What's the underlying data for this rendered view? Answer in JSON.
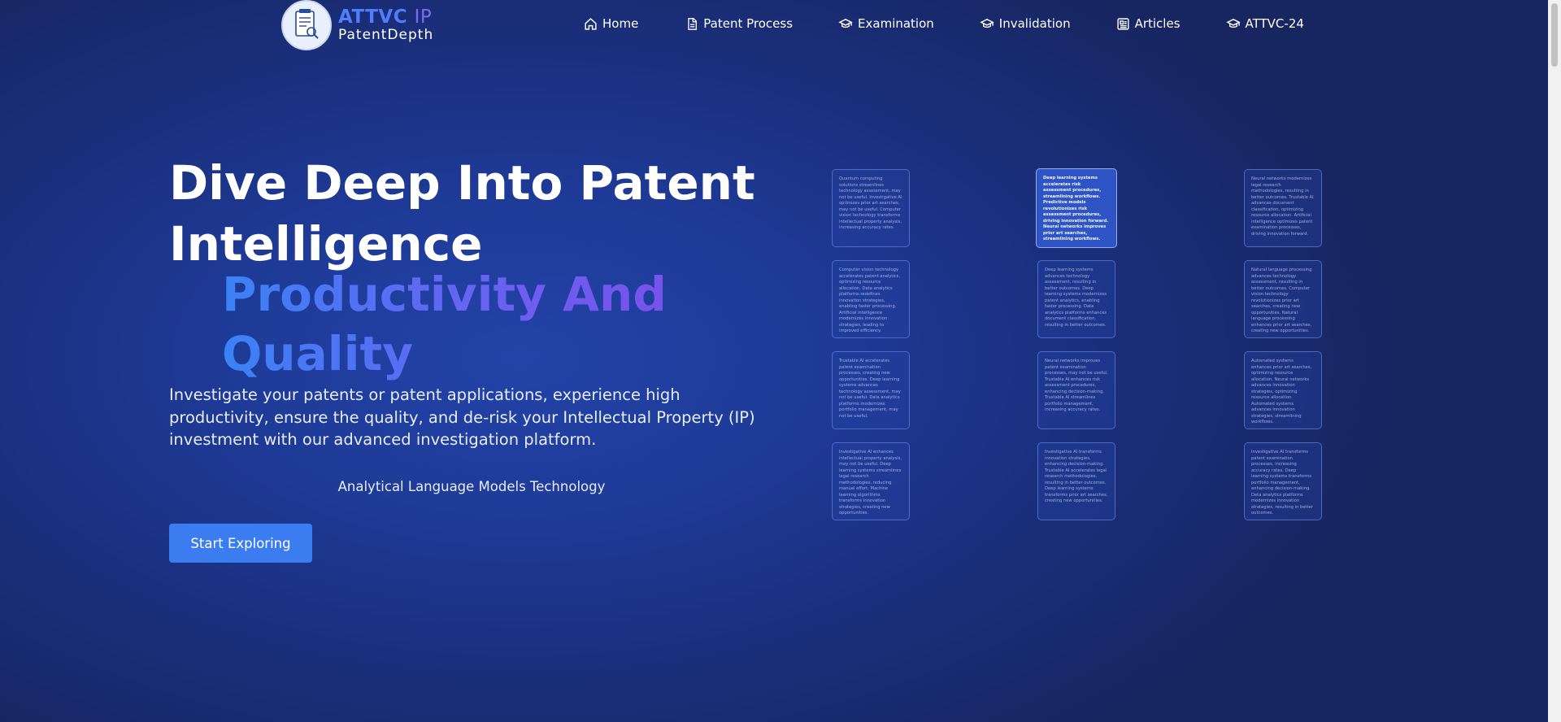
{
  "brand": {
    "name_main": "ATTVC",
    "name_suffix": "IP",
    "tagline": "PatentDepth",
    "colors": {
      "main": "#4f7dfb",
      "suffix": "#7c69f0"
    }
  },
  "nav": {
    "items": [
      {
        "label": "Home",
        "icon": "home-icon"
      },
      {
        "label": "Patent Process",
        "icon": "document-icon"
      },
      {
        "label": "Examination",
        "icon": "graduation-cap-icon"
      },
      {
        "label": "Invalidation",
        "icon": "graduation-cap-icon"
      },
      {
        "label": "Articles",
        "icon": "newspaper-icon"
      },
      {
        "label": "ATTVC-24",
        "icon": "graduation-cap-icon"
      }
    ]
  },
  "hero": {
    "title_line1": "Dive Deep Into Patent",
    "title_line2": "Intelligence",
    "accent": "Productivity And Quality",
    "description": "Investigate your patents or patent applications, experience high productivity, ensure the quality, and de-risk your Intellectual Property (IP) investment with our advanced investigation platform.",
    "tech_label": "Analytical Language Models Technology",
    "cta_label": "Start Exploring",
    "accent_colors": [
      "#3b82f6",
      "#7c4ee8"
    ],
    "button_color": "#3b7cf0"
  },
  "cards": [
    "Quantum computing solutions streamlines technology assessment, may not be useful. Investigative AI optimizes prior art searches, may not be useful. Computer vision technology transforms intellectual property analysis, increasing accuracy rates.",
    "Deep learning systems accelerates risk assessment procedures, streamlining workflows. Predictive models revolutionizes risk assessment procedures, driving innovation forward. Neural networks improves prior art searches, streamlining workflows.",
    "Neural networks modernizes legal research methodologies, resulting in better outcomes. Trustable AI advances document classification, optimizing resource allocation. Artificial intelligence optimizes patent examination processes, driving innovation forward.",
    "Computer vision technology accelerates patent analytics, optimizing resource allocation. Data analytics platforms redefines innovation strategies, enabling faster processing. Artificial intelligence modernizes innovation strategies, leading to improved efficiency.",
    "Deep learning systems advances technology assessment, resulting in better outcomes. Deep learning systems modernizes patent analytics, enabling faster processing. Data analytics platforms enhances document classification, resulting in better outcomes.",
    "Natural language processing advances technology assessment, resulting in better outcomes. Computer vision technology revolutionizes prior art searches, creating new opportunities. Natural language processing enhances prior art searches, creating new opportunities.",
    "Trustable AI accelerates patent examination processes, creating new opportunities. Deep learning systems advances technology assessment, may not be useful. Data analytics platforms modernizes portfolio management, may not be useful.",
    "Neural networks improves patent examination processes, may not be useful. Trustable AI enhances risk assessment procedures, enhancing decision-making. Trustable AI streamlines portfolio management, increasing accuracy rates.",
    "Automated systems enhances prior art searches, optimizing resource allocation. Neural networks advances innovation strategies, optimizing resource allocation. Automated systems advances innovation strategies, streamlining workflows.",
    "Investigative AI enhances intellectual property analysis, may not be useful. Deep learning systems streamlines legal research methodologies, reducing manual effort. Machine learning algorithms transforms innovation strategies, creating new opportunities.",
    "Investigative AI transforms innovation strategies, enhancing decision-making. Trustable AI accelerates legal research methodologies, resulting in better outcomes. Deep learning systems transforms prior art searches, creating new opportunities.",
    "Investigative AI transforms patent examination processes, increasing accuracy rates. Deep learning systems transforms portfolio management, enhancing decision-making. Data analytics platforms modernizes innovation strategies, resulting in better outcomes."
  ]
}
